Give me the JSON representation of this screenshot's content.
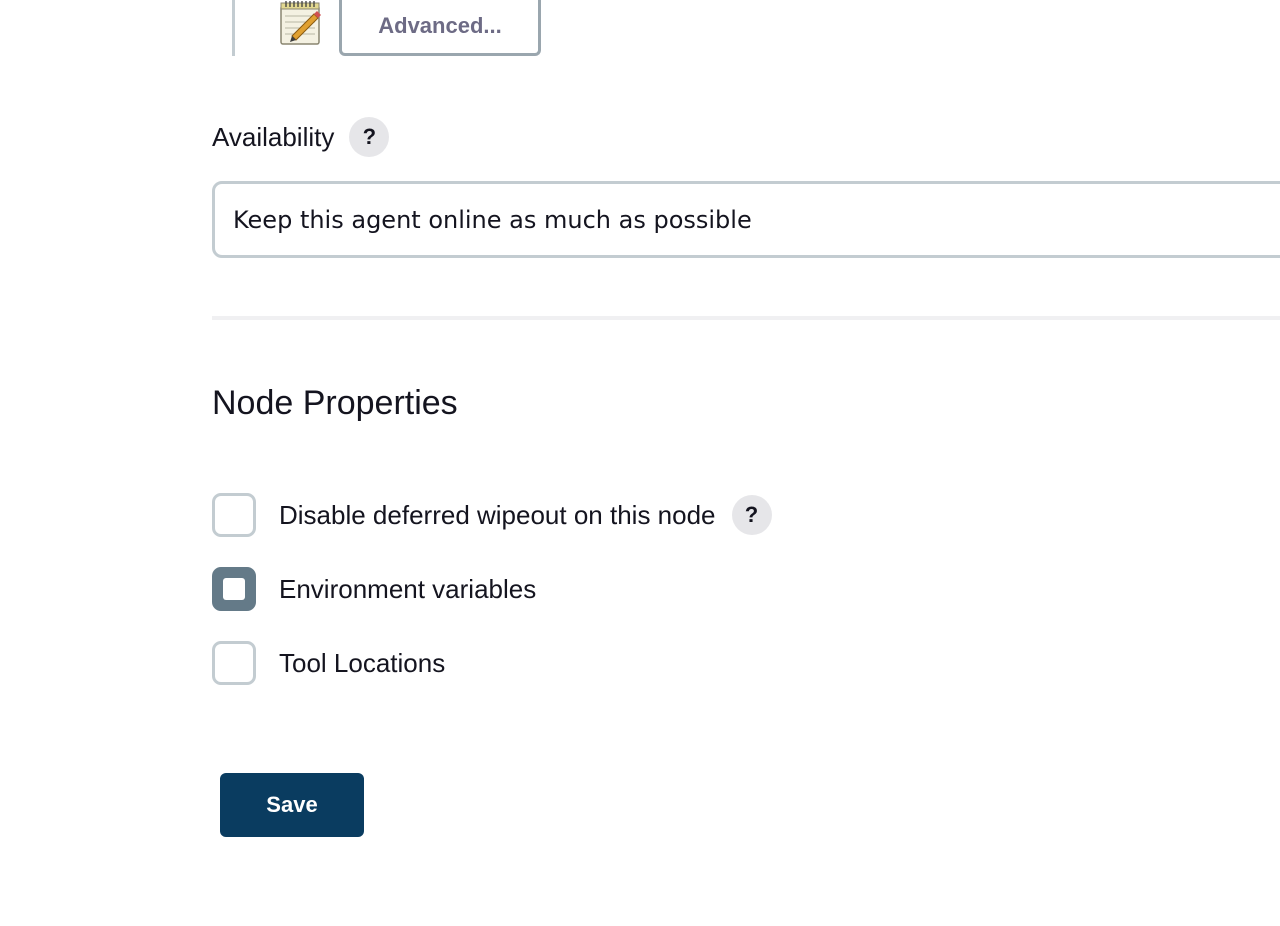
{
  "advanced": {
    "button_label": "Advanced...",
    "icon": "notepad-pencil-icon"
  },
  "availability": {
    "label": "Availability",
    "help_label": "?",
    "selected_value": "Keep this agent online as much as possible"
  },
  "node_properties": {
    "title": "Node Properties",
    "items": [
      {
        "label": "Disable deferred wipeout on this node",
        "checked": false,
        "has_help": true,
        "help_label": "?"
      },
      {
        "label": "Environment variables",
        "checked": false,
        "focused": true
      },
      {
        "label": "Tool Locations",
        "checked": false
      }
    ]
  },
  "actions": {
    "save_label": "Save"
  },
  "colors": {
    "primary": "#0a3c60",
    "border": "#c3ccd1",
    "focus": "#647a88",
    "help_bg": "#e6e6e9",
    "text": "#14141f"
  }
}
